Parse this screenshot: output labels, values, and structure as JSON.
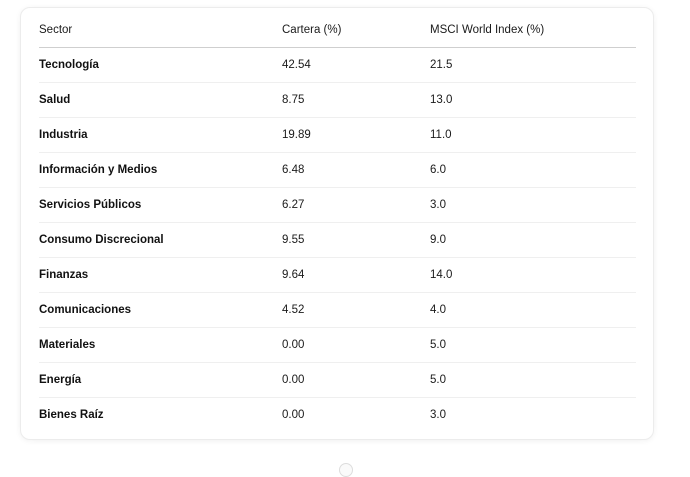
{
  "table": {
    "headers": [
      "Sector",
      "Cartera (%)",
      "MSCI World Index (%)"
    ],
    "rows": [
      {
        "sector": "Tecnología",
        "cartera": "42.54",
        "msci": "21.5"
      },
      {
        "sector": "Salud",
        "cartera": "8.75",
        "msci": "13.0"
      },
      {
        "sector": "Industria",
        "cartera": "19.89",
        "msci": "11.0"
      },
      {
        "sector": "Información y Medios",
        "cartera": "6.48",
        "msci": "6.0"
      },
      {
        "sector": "Servicios Públicos",
        "cartera": "6.27",
        "msci": "3.0"
      },
      {
        "sector": "Consumo Discrecional",
        "cartera": "9.55",
        "msci": "9.0"
      },
      {
        "sector": "Finanzas",
        "cartera": "9.64",
        "msci": "14.0"
      },
      {
        "sector": "Comunicaciones",
        "cartera": "4.52",
        "msci": "4.0"
      },
      {
        "sector": "Materiales",
        "cartera": "0.00",
        "msci": "5.0"
      },
      {
        "sector": "Energía",
        "cartera": "0.00",
        "msci": "5.0"
      },
      {
        "sector": "Bienes Raíz",
        "cartera": "0.00",
        "msci": "3.0"
      }
    ]
  }
}
